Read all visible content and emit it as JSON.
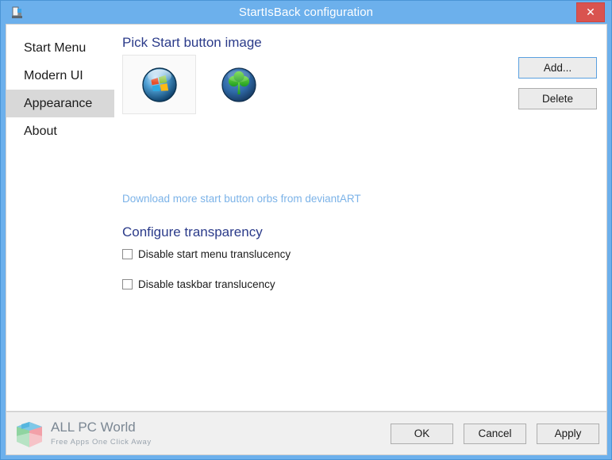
{
  "window": {
    "title": "StartIsBack configuration",
    "app_icon": "app-icon",
    "close_label": "✕",
    "frame_color": "#6cb0ec",
    "close_color": "#d9534f"
  },
  "sidebar": {
    "items": [
      {
        "label": "Start Menu",
        "selected": false
      },
      {
        "label": "Modern UI",
        "selected": false
      },
      {
        "label": "Appearance",
        "selected": true
      },
      {
        "label": "About",
        "selected": false
      }
    ],
    "selected_background": "#d8d8d8"
  },
  "main": {
    "heading_pick": "Pick Start button image",
    "heading_transparency": "Configure transparency",
    "heading_color": "#2b3b8a",
    "orbs": [
      {
        "name": "windows-orb",
        "selected": true
      },
      {
        "name": "shamrock-orb",
        "selected": false
      }
    ],
    "link": {
      "text": "Download more start button orbs from deviantART",
      "color": "#7cb3e8"
    },
    "checkboxes": [
      {
        "label": "Disable start menu translucency",
        "checked": false
      },
      {
        "label": "Disable taskbar translucency",
        "checked": false
      }
    ],
    "buttons": {
      "add": "Add...",
      "delete": "Delete"
    }
  },
  "footer": {
    "ok": "OK",
    "cancel": "Cancel",
    "apply": "Apply",
    "watermark_title": "ALL PC World",
    "watermark_subtitle": "Free Apps One Click Away"
  }
}
